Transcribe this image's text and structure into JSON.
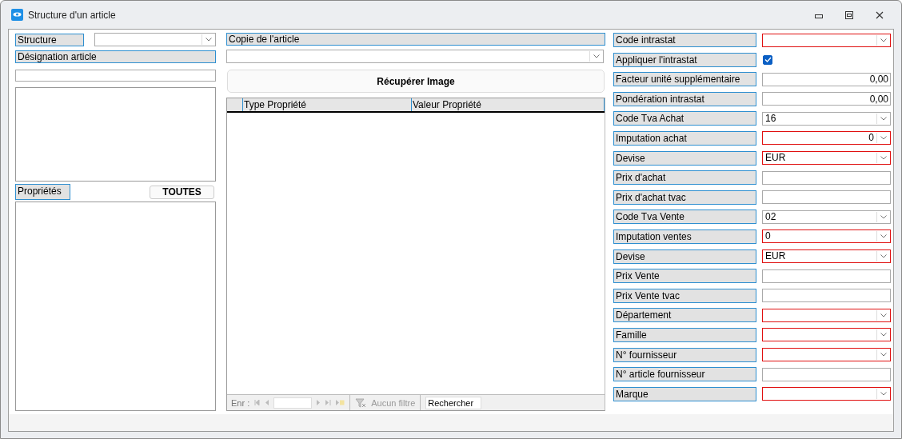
{
  "window": {
    "title": "Structure d'un article"
  },
  "left": {
    "structure_label": "Structure",
    "designation_label": "Désignation article",
    "properties_label": "Propriétés",
    "all_button": "TOUTES"
  },
  "middle": {
    "copy_label": "Copie de l'article",
    "image_button": "Récupérer Image",
    "grid": {
      "columns": [
        "Type Propriété",
        "Valeur Propriété"
      ]
    },
    "navigation": {
      "record_label": "Enr :",
      "filter": "Aucun filtre",
      "search": {
        "placeholder": "Rechercher"
      }
    }
  },
  "fields": [
    {
      "label": "Code intrastat",
      "kind": "combo",
      "required": true
    },
    {
      "label": "Appliquer l'intrastat",
      "kind": "checkbox",
      "checked": true
    },
    {
      "label": "Facteur unité supplémentaire",
      "kind": "text",
      "required": false,
      "value": "0,00",
      "right_aligned": true
    },
    {
      "label": "Pondération intrastat",
      "kind": "text",
      "required": false,
      "value": "0,00",
      "right_aligned": true
    },
    {
      "label": "Code Tva Achat",
      "kind": "combo",
      "required": false,
      "value": "16",
      "right_aligned": false
    },
    {
      "label": "Imputation achat",
      "kind": "combo",
      "required": true,
      "value": "0",
      "right_aligned": true
    },
    {
      "label": "Devise",
      "kind": "combo",
      "required": true,
      "value": "EUR",
      "right_aligned": false
    },
    {
      "label": "Prix d'achat",
      "kind": "text",
      "required": false
    },
    {
      "label": "Prix d'achat tvac",
      "kind": "text",
      "required": false
    },
    {
      "label": "Code Tva Vente",
      "kind": "combo",
      "required": false,
      "value": "02",
      "right_aligned": false
    },
    {
      "label": "Imputation ventes",
      "kind": "combo",
      "required": true,
      "value": "0",
      "right_aligned": false
    },
    {
      "label": "Devise",
      "kind": "combo",
      "required": true,
      "value": "EUR",
      "right_aligned": false
    },
    {
      "label": "Prix Vente",
      "kind": "text",
      "required": false
    },
    {
      "label": "Prix Vente tvac",
      "kind": "text",
      "required": false
    },
    {
      "label": "Département",
      "kind": "combo",
      "required": true
    },
    {
      "label": "Famille",
      "kind": "combo",
      "required": true
    },
    {
      "label": "N° fournisseur",
      "kind": "combo",
      "required": true
    },
    {
      "label": "N° article fournisseur",
      "kind": "text",
      "required": false
    },
    {
      "label": "Marque",
      "kind": "combo",
      "required": true
    }
  ]
}
